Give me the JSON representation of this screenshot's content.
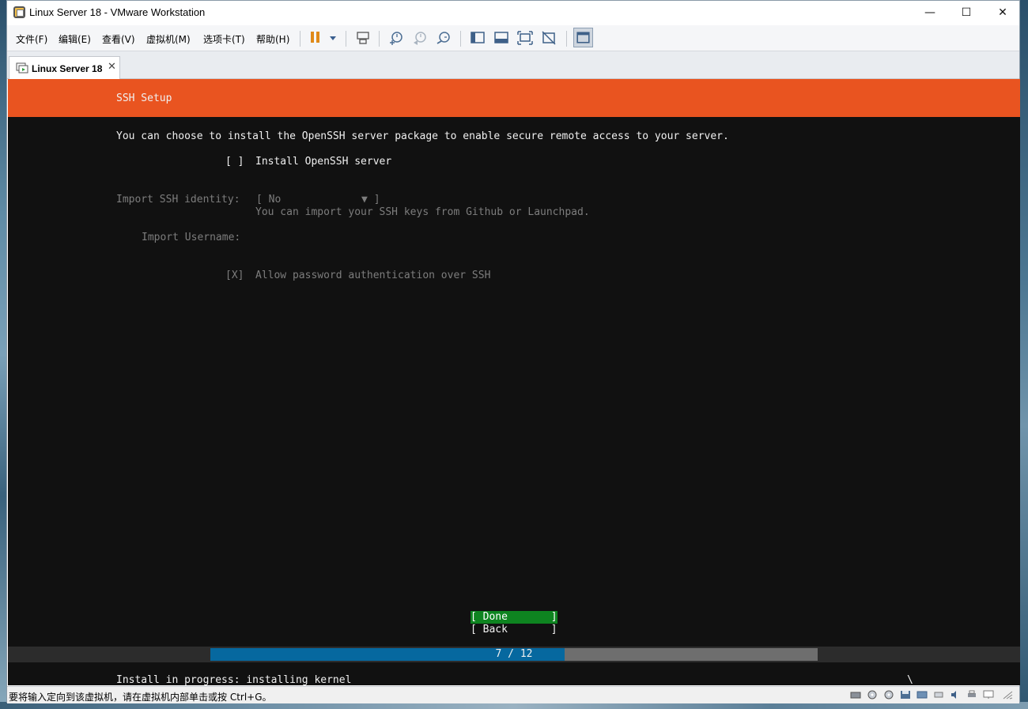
{
  "window": {
    "title": "Linux Server 18 - VMware Workstation",
    "controls": {
      "minimize": "—",
      "maximize": "☐",
      "close": "✕"
    }
  },
  "menubar": {
    "items": [
      "文件(F)",
      "编辑(E)",
      "查看(V)",
      "虚拟机(M)",
      "选项卡(T)",
      "帮助(H)"
    ]
  },
  "toolbar": {
    "icons": [
      "pause-icon",
      "send-ctrl-alt-del-icon",
      "snapshot-icon",
      "revert-snapshot-icon",
      "snapshot-manager-icon",
      "sidebar-icon",
      "thumbnail-icon",
      "fullscreen-icon",
      "unity-icon",
      "console-view-icon"
    ]
  },
  "tab": {
    "label": "Linux Server 18",
    "close": "✕"
  },
  "installer": {
    "header": "SSH Setup",
    "description": "You can choose to install the OpenSSH server package to enable secure remote access to your server.",
    "install_openssh": {
      "box": "[ ]",
      "label": "Install OpenSSH server"
    },
    "import_identity": {
      "label": "Import SSH identity:",
      "value": "[ No             ▼ ]",
      "hint": "You can import your SSH keys from Github or Launchpad."
    },
    "import_username": {
      "label": "Import Username:"
    },
    "allow_password": {
      "box": "[X]",
      "label": "Allow password authentication over SSH"
    },
    "buttons": {
      "done": "[ Done       ]",
      "back": "[ Back       ]"
    },
    "progress": {
      "text": "7 / 12",
      "current": 7,
      "total": 12
    },
    "status_line": "Install in progress: installing kernel",
    "spinner": "\\"
  },
  "statusbar": {
    "text": "要将输入定向到该虚拟机，请在虚拟机内部单击或按 Ctrl+G。"
  },
  "colors": {
    "header_orange": "#e95420",
    "done_green": "#0e8420",
    "progress_blue": "#06689f",
    "console_bg": "#111111"
  }
}
